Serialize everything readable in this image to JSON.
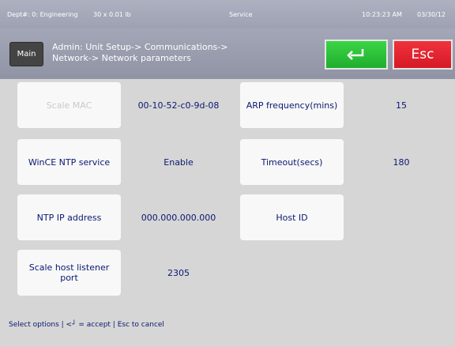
{
  "status_bar": {
    "dept": "Dept#: 0: Engineering",
    "capacity": "30 x 0.01 lb",
    "mode": "Service",
    "time": "10:23:23 AM",
    "date": "03/30/12"
  },
  "header": {
    "main_label": "Main",
    "breadcrumb_line1": "Admin: Unit Setup-> Communications->",
    "breadcrumb_line2": "Network-> Network parameters",
    "accept_icon": "enter-arrow-icon",
    "esc_label": "Esc"
  },
  "fields": {
    "scale_mac": {
      "label": "Scale MAC",
      "value": "00-10-52-c0-9d-08"
    },
    "arp_frequency": {
      "label": "ARP frequency(mins)",
      "value": "15"
    },
    "wince_ntp": {
      "label": "WinCE NTP service",
      "value": "Enable"
    },
    "timeout": {
      "label": "Timeout(secs)",
      "value": "180"
    },
    "ntp_ip": {
      "label": "NTP IP address",
      "value": "000.000.000.000"
    },
    "host_id": {
      "label": "Host ID",
      "value": ""
    },
    "listener_port": {
      "label": "Scale host listener port",
      "value": "2305"
    }
  },
  "footer": {
    "hint": "Select options | <┘ = accept | Esc to cancel"
  },
  "colors": {
    "accept": "#2fc43a",
    "esc": "#e8232f",
    "text": "#0a1870",
    "panel": "#d6d6d6"
  }
}
